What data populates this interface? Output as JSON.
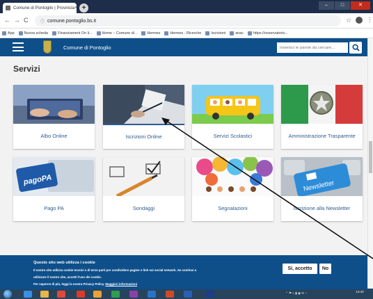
{
  "browser": {
    "tab_title": "Comune di Pontoglio | Provincia",
    "tab_close": "×",
    "new_tab": "+",
    "url": "comune.pontoglio.bs.it",
    "back_icon": "arrow-left",
    "forward_icon": "arrow-right",
    "reload_icon": "reload"
  },
  "bookmarks": [
    "App",
    "Nuova scheda",
    "Finanziament On li...",
    "Home :: Comune di...",
    "Hermes",
    "Hermes - Ricerche",
    "Iscrizioni",
    "anac",
    "https://osservatorio..."
  ],
  "site": {
    "name": "Comune di Pontoglio",
    "search_placeholder": "Inserisci le parole da cercare...",
    "header_color": "#0e4f8a"
  },
  "main": {
    "heading": "Servizi",
    "cards": [
      {
        "label": "Albo Online",
        "image": "hands-laptop"
      },
      {
        "label": "Iscrizioni Online",
        "image": "business-pen"
      },
      {
        "label": "Servizi Scolastici",
        "image": "school-bus"
      },
      {
        "label": "Amministrazione Trasparente",
        "image": "italian-emblem"
      },
      {
        "label": "Pago PA",
        "image": "pagopa-card"
      },
      {
        "label": "Sondaggi",
        "image": "checkbox-paper"
      },
      {
        "label": "Segnalazioni",
        "image": "colorful-balloons"
      },
      {
        "label": "Iscrizione alla Newsletter",
        "image": "newsletter-key"
      }
    ]
  },
  "cookie": {
    "title": "Questo sito web utilizza i cookie",
    "line1": "Il nostro sito utilizza cookie tecnici e di terze parti per condividere pagine e link sui social network. Se continui a",
    "line2": "utilizzare il nostro sito, accetti l'uso dei cookie.",
    "line3": "Per saperne di più, leggi la nostra Privacy Policy.",
    "more_link": "Maggiori informazioni",
    "accept_label": "Sì, accetto",
    "decline_label": "No"
  },
  "taskbar": {
    "clock_time": "13:43"
  }
}
